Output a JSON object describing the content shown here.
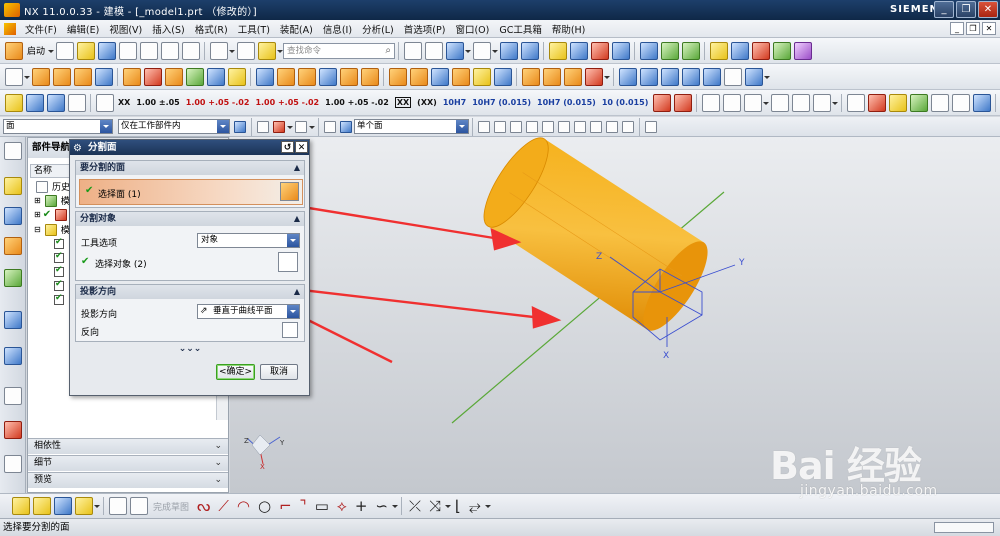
{
  "window": {
    "title": "NX 11.0.0.33 - 建模 - [_model1.prt （修改的）]",
    "brand": "SIEMENS",
    "controls": [
      "_",
      "❐",
      "✕"
    ]
  },
  "menu": {
    "items": [
      "文件(F)",
      "编辑(E)",
      "视图(V)",
      "插入(S)",
      "格式(R)",
      "工具(T)",
      "装配(A)",
      "信息(I)",
      "分析(L)",
      "首选项(P)",
      "窗口(O)",
      "GC工具箱",
      "帮助(H)"
    ],
    "doc_controls": [
      "_",
      "❐",
      "✕"
    ]
  },
  "toolbar1": {
    "start_label": "启动",
    "search_placeholder": "查找命令"
  },
  "toolbar3": {
    "labels": [
      "XX",
      "1.00\n±.05",
      "1.00\n+.05\n-.02",
      "1.00\n+.05\n-.02",
      "1.00\n+.05\n-.02",
      "XX",
      "(XX)",
      "10H7",
      "10H7\n(0.015)",
      "10H7\n(0.015)",
      "10\n(0.015)"
    ]
  },
  "selection_bar": {
    "filter": "面",
    "scope": "仅在工作部件内",
    "face_rule": "单个面"
  },
  "part_navigator": {
    "title": "部件导航器",
    "column_name": "名称",
    "rows": [
      "历史",
      "模型",
      "模",
      "模型"
    ],
    "bottom_sections": [
      "相依性",
      "细节",
      "预览"
    ]
  },
  "dialog": {
    "title": "分割面",
    "title_buttons": [
      "↺",
      "✕"
    ],
    "section_face": "要分割的面",
    "select_face": "选择面 (1)",
    "section_objects": "分割对象",
    "tool_option_label": "工具选项",
    "tool_option_value": "对象",
    "select_object": "选择对象 (2)",
    "section_projection": "投影方向",
    "projection_label": "投影方向",
    "projection_value": "垂直于曲线平面",
    "reverse_label": "反向",
    "more": "⌄⌄⌄",
    "ok": "<确定>",
    "cancel": "取消"
  },
  "bottom_toolbar": {
    "sketch_label": "完成草图"
  },
  "status": {
    "message": "选择要分割的面"
  },
  "graphics": {
    "axis_labels": {
      "y": "Y",
      "z": "Z",
      "x": "X"
    },
    "triad_labels": {
      "y": "Y",
      "z": "Z",
      "x": "X"
    }
  },
  "watermark": {
    "brand": "Bai  经验",
    "url": "jingyan.baidu.com"
  },
  "colors": {
    "title_bar": "#1b3356",
    "cylinder": "#f2a413",
    "selection_highlight": "#eeb086",
    "arrow": "#f03030"
  }
}
